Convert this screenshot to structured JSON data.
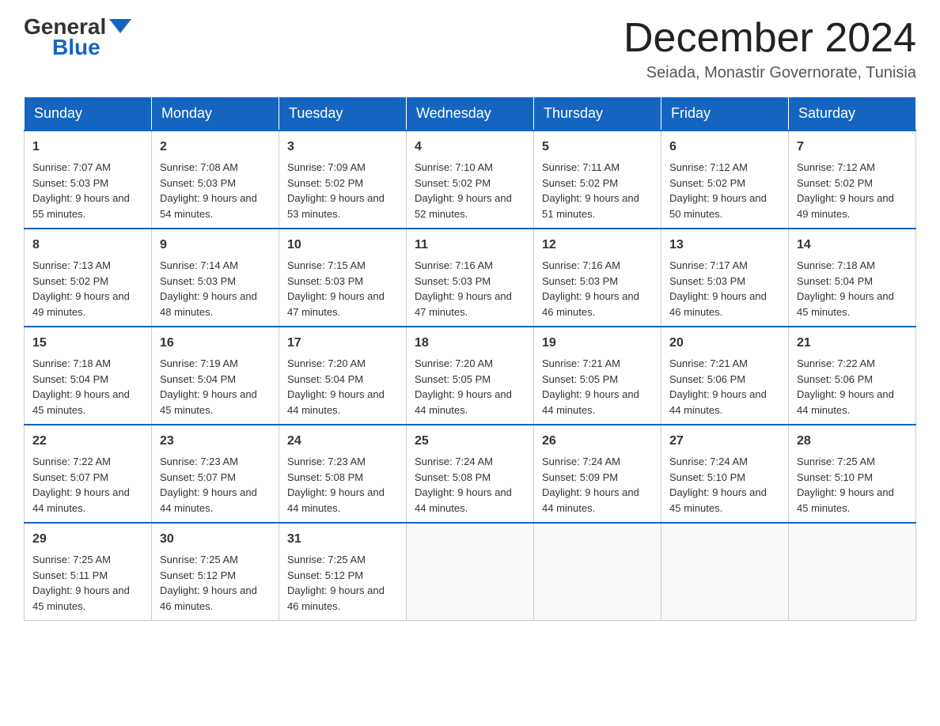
{
  "header": {
    "logo_general": "General",
    "logo_blue": "Blue",
    "title": "December 2024",
    "location": "Seiada, Monastir Governorate, Tunisia"
  },
  "weekdays": [
    "Sunday",
    "Monday",
    "Tuesday",
    "Wednesday",
    "Thursday",
    "Friday",
    "Saturday"
  ],
  "weeks": [
    [
      {
        "day": "1",
        "sunrise": "7:07 AM",
        "sunset": "5:03 PM",
        "daylight": "9 hours and 55 minutes."
      },
      {
        "day": "2",
        "sunrise": "7:08 AM",
        "sunset": "5:03 PM",
        "daylight": "9 hours and 54 minutes."
      },
      {
        "day": "3",
        "sunrise": "7:09 AM",
        "sunset": "5:02 PM",
        "daylight": "9 hours and 53 minutes."
      },
      {
        "day": "4",
        "sunrise": "7:10 AM",
        "sunset": "5:02 PM",
        "daylight": "9 hours and 52 minutes."
      },
      {
        "day": "5",
        "sunrise": "7:11 AM",
        "sunset": "5:02 PM",
        "daylight": "9 hours and 51 minutes."
      },
      {
        "day": "6",
        "sunrise": "7:12 AM",
        "sunset": "5:02 PM",
        "daylight": "9 hours and 50 minutes."
      },
      {
        "day": "7",
        "sunrise": "7:12 AM",
        "sunset": "5:02 PM",
        "daylight": "9 hours and 49 minutes."
      }
    ],
    [
      {
        "day": "8",
        "sunrise": "7:13 AM",
        "sunset": "5:02 PM",
        "daylight": "9 hours and 49 minutes."
      },
      {
        "day": "9",
        "sunrise": "7:14 AM",
        "sunset": "5:03 PM",
        "daylight": "9 hours and 48 minutes."
      },
      {
        "day": "10",
        "sunrise": "7:15 AM",
        "sunset": "5:03 PM",
        "daylight": "9 hours and 47 minutes."
      },
      {
        "day": "11",
        "sunrise": "7:16 AM",
        "sunset": "5:03 PM",
        "daylight": "9 hours and 47 minutes."
      },
      {
        "day": "12",
        "sunrise": "7:16 AM",
        "sunset": "5:03 PM",
        "daylight": "9 hours and 46 minutes."
      },
      {
        "day": "13",
        "sunrise": "7:17 AM",
        "sunset": "5:03 PM",
        "daylight": "9 hours and 46 minutes."
      },
      {
        "day": "14",
        "sunrise": "7:18 AM",
        "sunset": "5:04 PM",
        "daylight": "9 hours and 45 minutes."
      }
    ],
    [
      {
        "day": "15",
        "sunrise": "7:18 AM",
        "sunset": "5:04 PM",
        "daylight": "9 hours and 45 minutes."
      },
      {
        "day": "16",
        "sunrise": "7:19 AM",
        "sunset": "5:04 PM",
        "daylight": "9 hours and 45 minutes."
      },
      {
        "day": "17",
        "sunrise": "7:20 AM",
        "sunset": "5:04 PM",
        "daylight": "9 hours and 44 minutes."
      },
      {
        "day": "18",
        "sunrise": "7:20 AM",
        "sunset": "5:05 PM",
        "daylight": "9 hours and 44 minutes."
      },
      {
        "day": "19",
        "sunrise": "7:21 AM",
        "sunset": "5:05 PM",
        "daylight": "9 hours and 44 minutes."
      },
      {
        "day": "20",
        "sunrise": "7:21 AM",
        "sunset": "5:06 PM",
        "daylight": "9 hours and 44 minutes."
      },
      {
        "day": "21",
        "sunrise": "7:22 AM",
        "sunset": "5:06 PM",
        "daylight": "9 hours and 44 minutes."
      }
    ],
    [
      {
        "day": "22",
        "sunrise": "7:22 AM",
        "sunset": "5:07 PM",
        "daylight": "9 hours and 44 minutes."
      },
      {
        "day": "23",
        "sunrise": "7:23 AM",
        "sunset": "5:07 PM",
        "daylight": "9 hours and 44 minutes."
      },
      {
        "day": "24",
        "sunrise": "7:23 AM",
        "sunset": "5:08 PM",
        "daylight": "9 hours and 44 minutes."
      },
      {
        "day": "25",
        "sunrise": "7:24 AM",
        "sunset": "5:08 PM",
        "daylight": "9 hours and 44 minutes."
      },
      {
        "day": "26",
        "sunrise": "7:24 AM",
        "sunset": "5:09 PM",
        "daylight": "9 hours and 44 minutes."
      },
      {
        "day": "27",
        "sunrise": "7:24 AM",
        "sunset": "5:10 PM",
        "daylight": "9 hours and 45 minutes."
      },
      {
        "day": "28",
        "sunrise": "7:25 AM",
        "sunset": "5:10 PM",
        "daylight": "9 hours and 45 minutes."
      }
    ],
    [
      {
        "day": "29",
        "sunrise": "7:25 AM",
        "sunset": "5:11 PM",
        "daylight": "9 hours and 45 minutes."
      },
      {
        "day": "30",
        "sunrise": "7:25 AM",
        "sunset": "5:12 PM",
        "daylight": "9 hours and 46 minutes."
      },
      {
        "day": "31",
        "sunrise": "7:25 AM",
        "sunset": "5:12 PM",
        "daylight": "9 hours and 46 minutes."
      },
      null,
      null,
      null,
      null
    ]
  ]
}
